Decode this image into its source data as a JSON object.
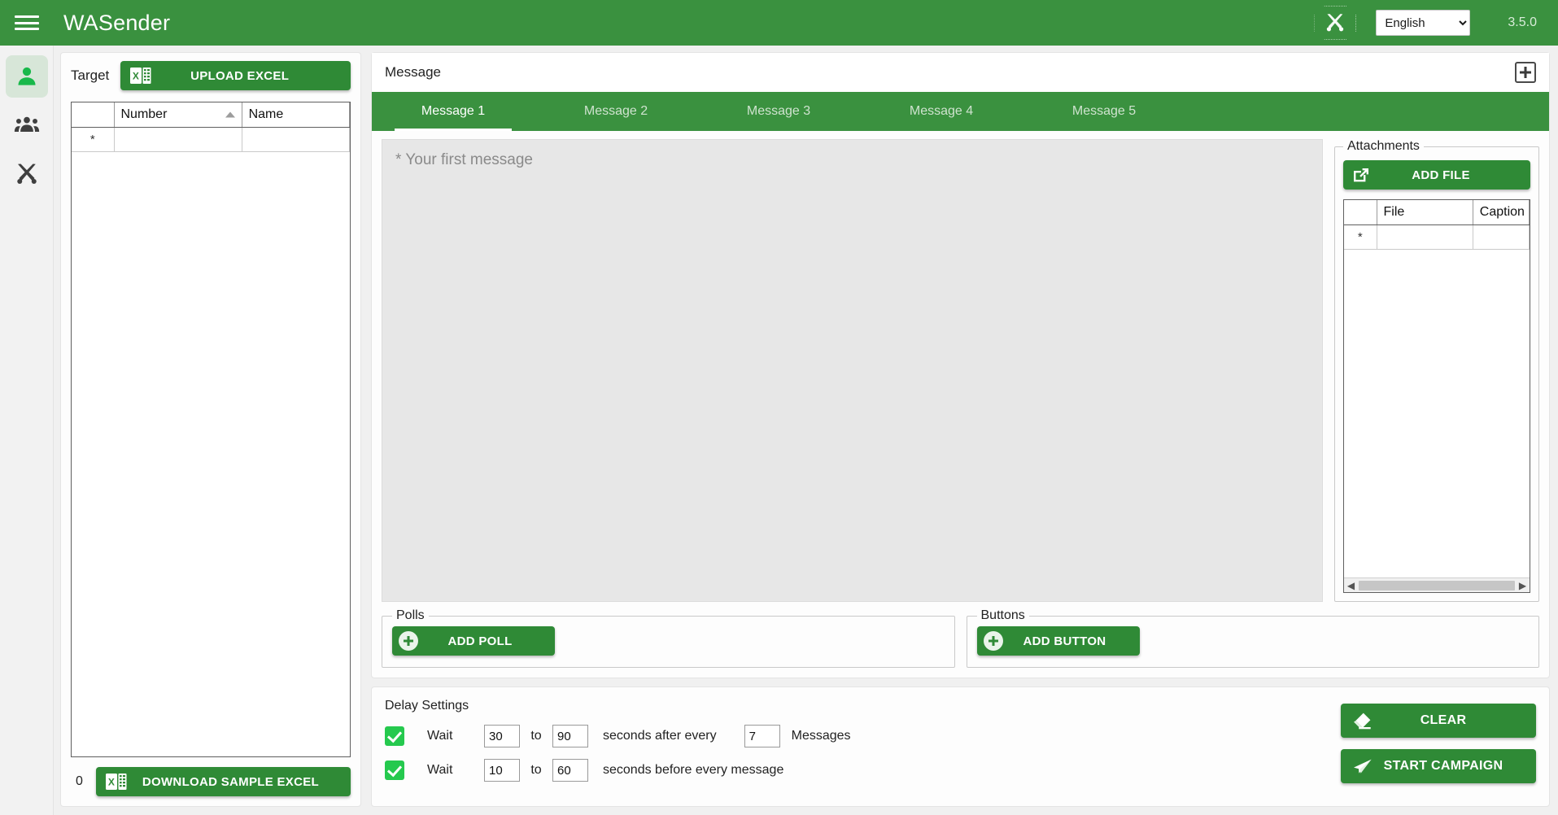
{
  "header": {
    "menu_icon": "hamburger-menu-icon",
    "brand": "WASender",
    "tools_icon": "tools-icon",
    "language_selected": "English",
    "language_options": [
      "English"
    ],
    "version": "3.5.0"
  },
  "sidebar": {
    "items": [
      {
        "icon": "single-contact-icon",
        "name": "contacts",
        "active": true
      },
      {
        "icon": "group-contacts-icon",
        "name": "groups",
        "active": false
      },
      {
        "icon": "tools-icon",
        "name": "tools",
        "active": false
      }
    ]
  },
  "target": {
    "label": "Target",
    "upload_button": "UPLOAD EXCEL",
    "upload_icon": "excel-file-icon",
    "columns": [
      "",
      "Number",
      "Name"
    ],
    "sort_column": "Number",
    "sort_direction": "asc",
    "rows": [
      {
        "marker": "*",
        "number": "",
        "name": ""
      }
    ],
    "count": "0",
    "download_button": "DOWNLOAD SAMPLE EXCEL",
    "download_icon": "excel-file-icon"
  },
  "message": {
    "card_title": "Message",
    "add_tab_icon": "add-square-icon",
    "tabs": [
      {
        "label": "Message 1",
        "active": true
      },
      {
        "label": "Message 2",
        "active": false
      },
      {
        "label": "Message 3",
        "active": false
      },
      {
        "label": "Message 4",
        "active": false
      },
      {
        "label": "Message 5",
        "active": false
      }
    ],
    "textarea_value": "",
    "textarea_placeholder": "* Your first message"
  },
  "attachments": {
    "legend": "Attachments",
    "add_file_button": "ADD FILE",
    "add_file_icon": "external-link-icon",
    "columns": [
      "",
      "File",
      "Caption"
    ],
    "rows": [
      {
        "marker": "*",
        "file": "",
        "caption": ""
      }
    ],
    "scroll_left_icon": "chevron-left-icon",
    "scroll_right_icon": "chevron-right-icon"
  },
  "polls": {
    "legend": "Polls",
    "add_button": "ADD POLL",
    "add_icon": "plus-circle-icon"
  },
  "buttons_section": {
    "legend": "Buttons",
    "add_button": "ADD BUTTON",
    "add_icon": "plus-circle-icon"
  },
  "delay": {
    "title": "Delay Settings",
    "row1": {
      "checked": true,
      "wait_label": "Wait",
      "from": "30",
      "to_label": "to",
      "to": "90",
      "middle_label": "seconds after every",
      "count": "7",
      "end_label": "Messages"
    },
    "row2": {
      "checked": true,
      "wait_label": "Wait",
      "from": "10",
      "to_label": "to",
      "to": "60",
      "middle_label": "seconds before every message"
    },
    "clear_button": "CLEAR",
    "clear_icon": "eraser-icon",
    "start_button": "START CAMPAIGN",
    "start_icon": "send-plane-icon"
  },
  "colors": {
    "brand_green": "#3a913f",
    "button_green": "#2f8a36",
    "checkbox_green": "#25c94e",
    "active_rail": "#d7e6d8"
  }
}
